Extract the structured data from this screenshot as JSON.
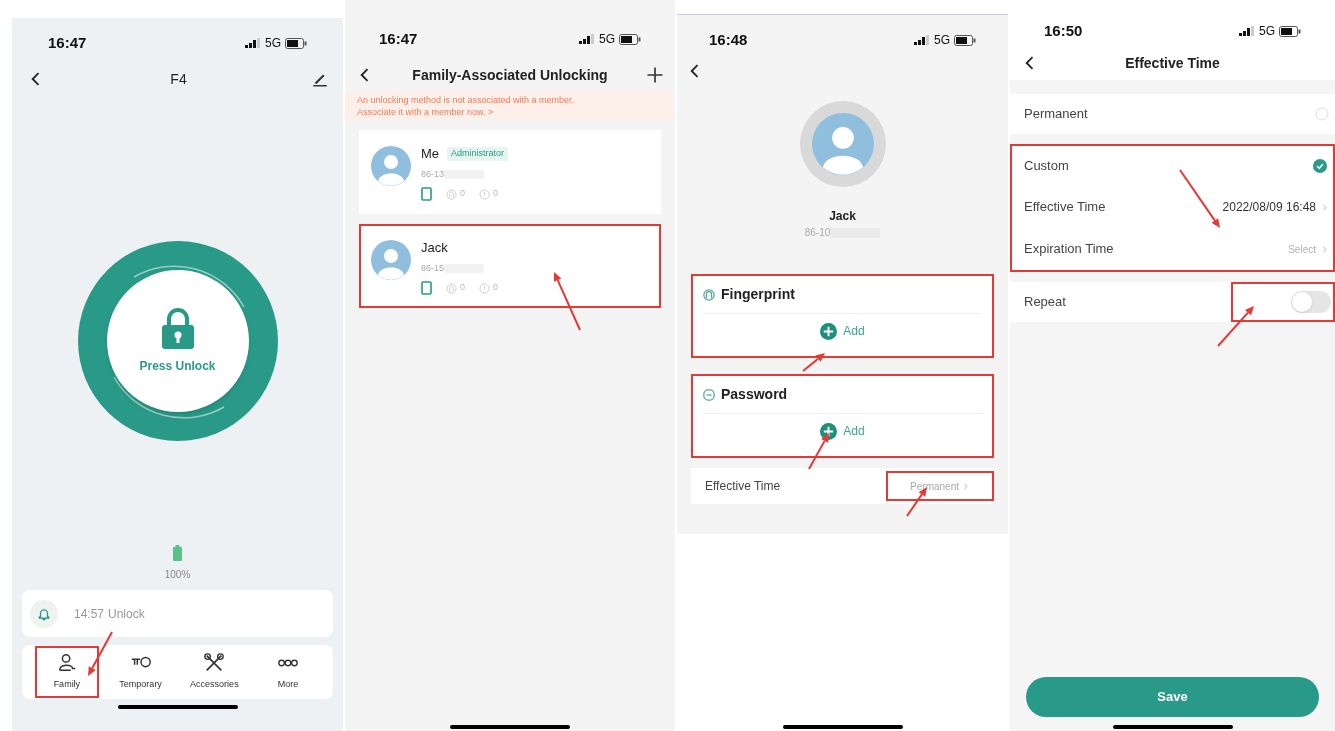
{
  "screens": [
    {
      "kind": "lock_home",
      "status_bar": {
        "time": "16:47",
        "network": "5G"
      },
      "title": "F4",
      "lock_label": "Press Unlock",
      "battery_text": "100%",
      "last_event": {
        "time": "14:57",
        "text": "Unlock"
      },
      "nav_items": [
        {
          "kind": "family",
          "label": "Family",
          "annotated": true
        },
        {
          "kind": "key",
          "label": "Temporary",
          "annotated": false
        },
        {
          "kind": "tools",
          "label": "Accessories",
          "annotated": false
        },
        {
          "kind": "more",
          "label": "More",
          "annotated": false
        }
      ]
    },
    {
      "kind": "member_list",
      "status_bar": {
        "time": "16:47",
        "network": "5G"
      },
      "title": "Family-Associated Unlocking",
      "notice": [
        "An unlocking method is not associated with a member.",
        "Associate it with a member now. >"
      ],
      "members": [
        {
          "name": "Me",
          "badge": "Administrator",
          "phone": "86-13",
          "fingerprint_count": "0",
          "password_count": "0",
          "annotated": false
        },
        {
          "name": "Jack",
          "phone": "86-15",
          "fingerprint_count": "0",
          "password_count": "0",
          "annotated": true
        }
      ]
    },
    {
      "kind": "member_detail",
      "status_bar": {
        "time": "16:48",
        "network": "5G"
      },
      "name": "Jack",
      "phone": "86-10",
      "methods": [
        {
          "kind": "fingerprint",
          "title": "Fingerprint",
          "action": "Add",
          "annotated": true
        },
        {
          "kind": "password",
          "title": "Password",
          "action": "Add",
          "annotated": true
        }
      ],
      "effective_time": {
        "label": "Effective Time",
        "value": "Permanent",
        "annotated": true
      }
    },
    {
      "kind": "effective_time",
      "status_bar": {
        "time": "16:50",
        "network": "5G"
      },
      "title": "Effective Time",
      "options": [
        {
          "label": "Permanent",
          "selected": false
        },
        {
          "label": "Custom",
          "selected": true
        }
      ],
      "custom_annotated": true,
      "custom_fields": [
        {
          "label": "Effective Time",
          "value": "2022/08/09 16:48"
        },
        {
          "label": "Expiration Time",
          "placeholder": "Select"
        }
      ],
      "repeat": {
        "label": "Repeat",
        "on": false,
        "annotated": true
      },
      "save_label": "Save"
    }
  ]
}
